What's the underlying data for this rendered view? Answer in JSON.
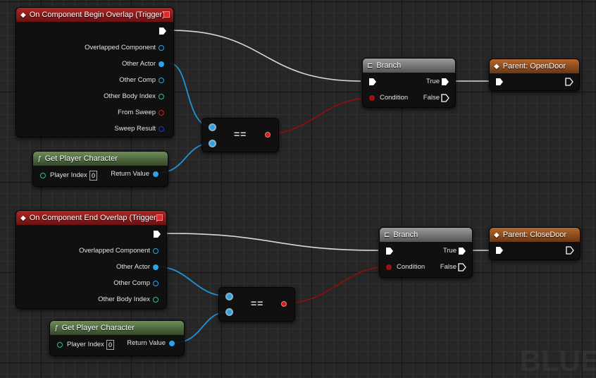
{
  "watermark": "BLUE",
  "events": [
    {
      "title": "On Component Begin Overlap (Trigger)",
      "pins": [
        "Overlapped Component",
        "Other Actor",
        "Other Comp",
        "Other Body Index",
        "From Sweep",
        "Sweep Result"
      ]
    },
    {
      "title": "On Component End Overlap (Trigger)",
      "pins": [
        "Overlapped Component",
        "Other Actor",
        "Other Comp",
        "Other Body Index"
      ]
    }
  ],
  "get_player": [
    {
      "title": "Get Player Character",
      "input_label": "Player Index",
      "input_value": "0",
      "output_label": "Return Value"
    },
    {
      "title": "Get Player Character",
      "input_label": "Player Index",
      "input_value": "0",
      "output_label": "Return Value"
    }
  ],
  "equal": [
    {
      "label": "=="
    },
    {
      "label": "=="
    }
  ],
  "branches": [
    {
      "title": "Branch",
      "condition": "Condition",
      "true_label": "True",
      "false_label": "False"
    },
    {
      "title": "Branch",
      "condition": "Condition",
      "true_label": "True",
      "false_label": "False"
    }
  ],
  "parent_calls": [
    {
      "title": "Parent: OpenDoor"
    },
    {
      "title": "Parent: CloseDoor"
    }
  ],
  "colors": {
    "event_header": "#b02424",
    "function_header": "#6c8e58",
    "branch_header": "#9c9c9c",
    "parent_header": "#b4672e",
    "object_pin": "#2aa3e8",
    "bool_pin": "#a01010",
    "int_pin": "#1ec89a",
    "exec_wire": "#e8e8e8"
  }
}
